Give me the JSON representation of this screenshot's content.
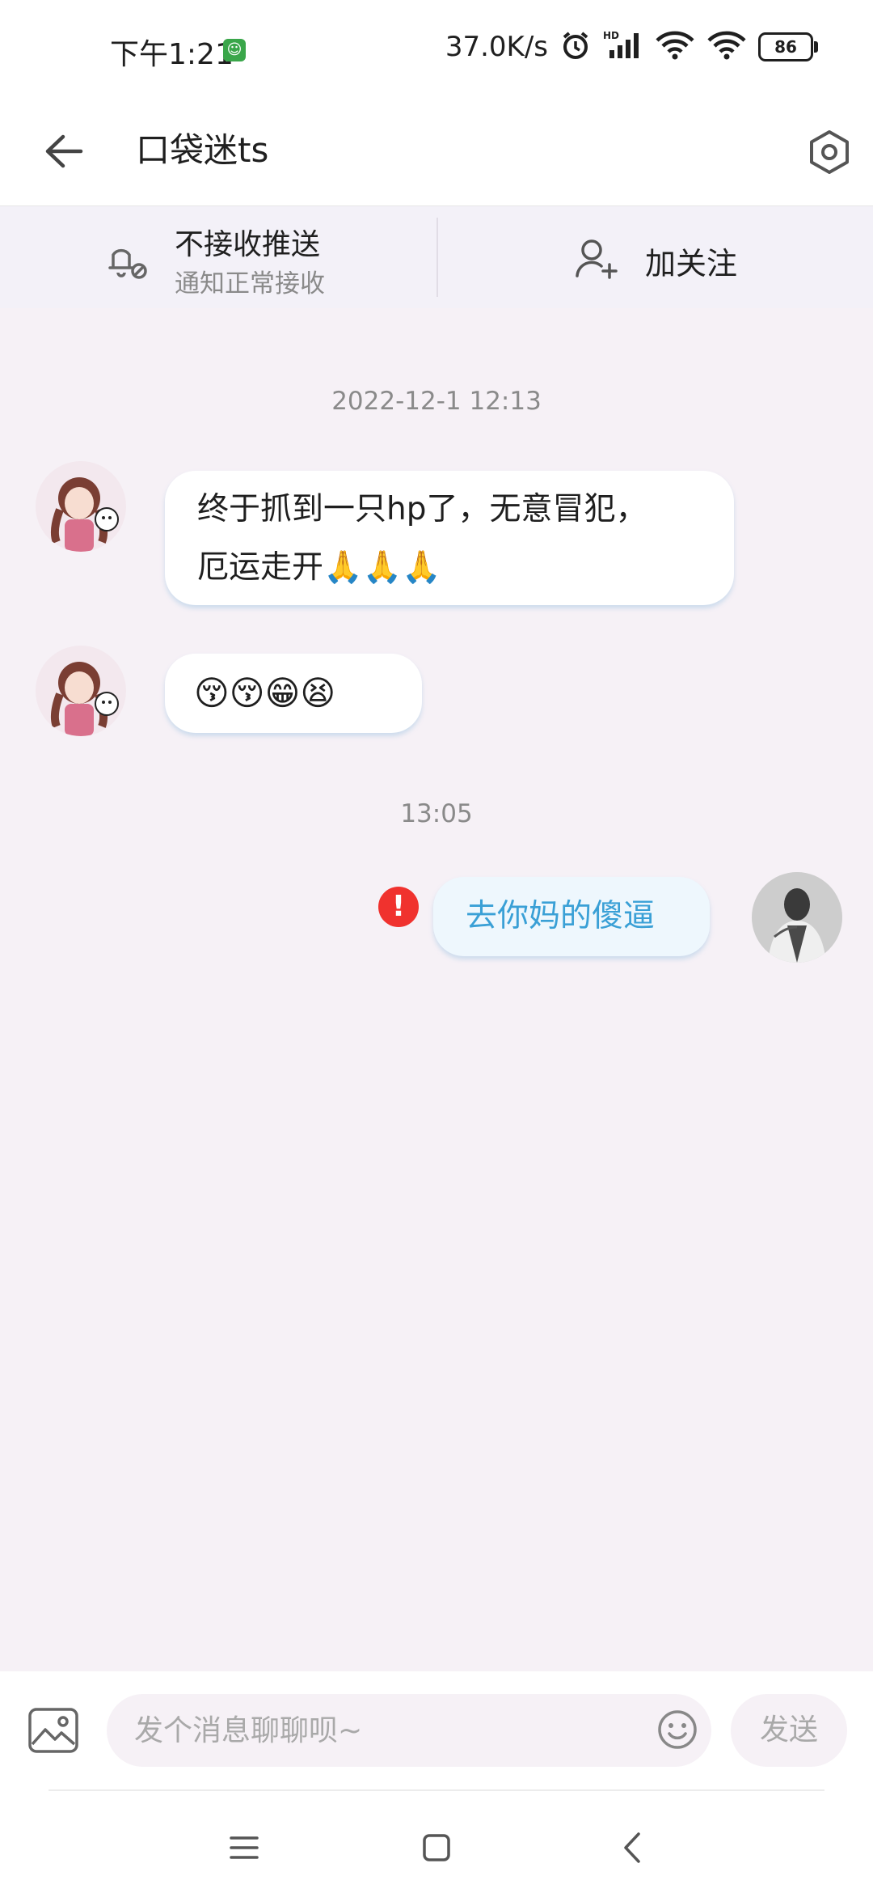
{
  "status_bar": {
    "time": "下午1:21",
    "app_icon": "assistant-icon",
    "net_speed": "37.0K/s",
    "icons": [
      "alarm-icon",
      "hd-signal-icon",
      "wifi-icon",
      "wifi-link-icon"
    ],
    "battery": "86"
  },
  "header": {
    "back_icon": "arrow-left-icon",
    "title": "口袋迷ts",
    "settings_icon": "hexagon-settings-icon"
  },
  "subscription_bar": {
    "push_title": "不接收推送",
    "push_subtitle": "通知正常接收",
    "follow_label": "加关注"
  },
  "messages": {
    "time_1": "2022-12-1 12:13",
    "msg_1": {
      "line_1": "终于抓到一只hp了，无意冒犯，",
      "line_2": "厄运走开🙏🙏🙏"
    },
    "msg_2": "😚😚😁😫",
    "time_2": "13:05",
    "msg_3": "去你妈的傻逼",
    "msg_3_status": "error"
  },
  "input_bar": {
    "placeholder": "发个消息聊聊呗~",
    "send_label": "发送"
  },
  "colors": {
    "accent_blue": "#3aa0d6",
    "error_red": "#f0322e",
    "page_bg": "#f6f1f6"
  }
}
